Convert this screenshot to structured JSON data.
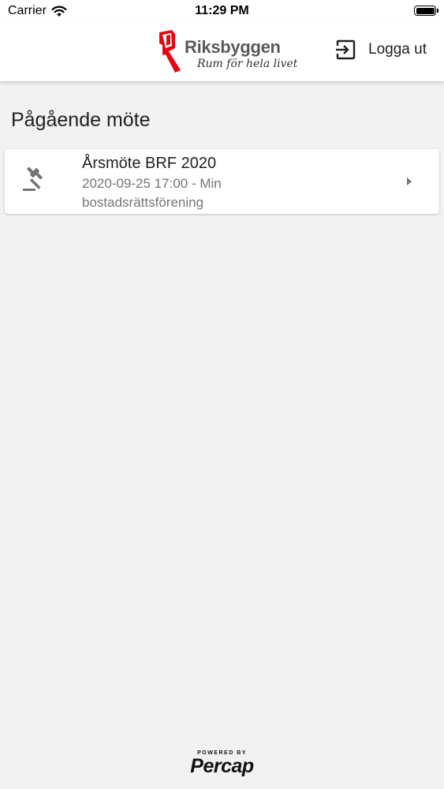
{
  "status_bar": {
    "carrier": "Carrier",
    "time": "11:29 PM"
  },
  "header": {
    "logo_name": "Riksbyggen",
    "logo_tagline": "Rum för hela livet",
    "logout_label": "Logga ut",
    "brand_color": "#e30613",
    "logout_icon": "logout-icon"
  },
  "main": {
    "section_title": "Pågående möte",
    "meetings": [
      {
        "title": "Årsmöte BRF 2020",
        "subtitle": "2020-09-25 17:00 - Min bostadsrättsförening",
        "icon": "gavel-icon"
      }
    ]
  },
  "footer": {
    "powered_by": "POWERED BY",
    "brand": "Percap"
  }
}
